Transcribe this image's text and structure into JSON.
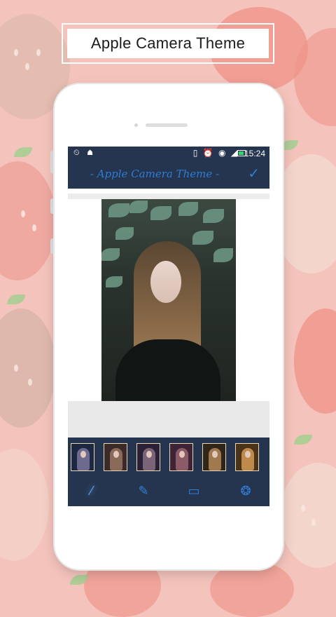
{
  "banner": {
    "title": "Apple Camera Theme"
  },
  "statusbar": {
    "left_icons": "⏲ ☗",
    "right_icons": "▯ ⏰ ◉ ◢",
    "time": "15:24"
  },
  "appbar": {
    "title": "- Apple Camera Theme -",
    "confirm_icon": "check-icon"
  },
  "filters": [
    {
      "name": "filter-1",
      "color": "#1c2742"
    },
    {
      "name": "filter-2",
      "color": "#3b2a2a"
    },
    {
      "name": "filter-3",
      "color": "#2b2136"
    },
    {
      "name": "filter-4",
      "color": "#3d2335"
    },
    {
      "name": "filter-5",
      "color": "#2f2619"
    },
    {
      "name": "filter-6",
      "color": "#4a3318"
    }
  ],
  "toolbar": {
    "tools": [
      "magic-wand-icon",
      "pencil-icon",
      "frame-icon",
      "aperture-icon"
    ]
  },
  "colors": {
    "background": "#f4c4bc",
    "bar": "#25354f",
    "accent": "#2d7dd2"
  }
}
